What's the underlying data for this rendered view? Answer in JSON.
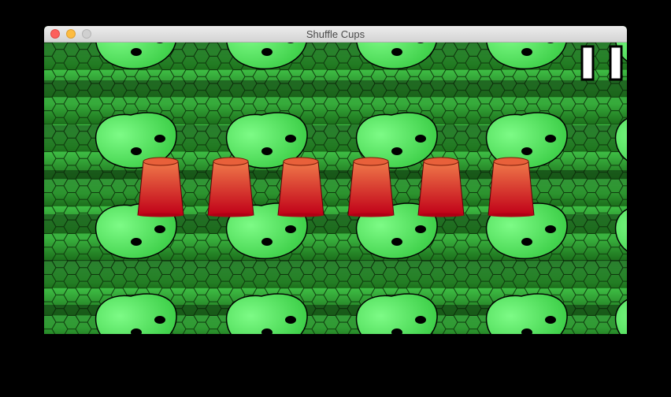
{
  "window": {
    "title": "Shuffle Cups"
  },
  "game": {
    "cup_count": 6,
    "icons": {
      "pause": "pause-icon",
      "cup": "red-cup"
    },
    "colors": {
      "cup_top": "#f07a4a",
      "cup_bottom": "#c00018",
      "scale_light": "#45c94a",
      "scale_dark": "#1f7a1e",
      "head": "#5cf06a"
    }
  }
}
